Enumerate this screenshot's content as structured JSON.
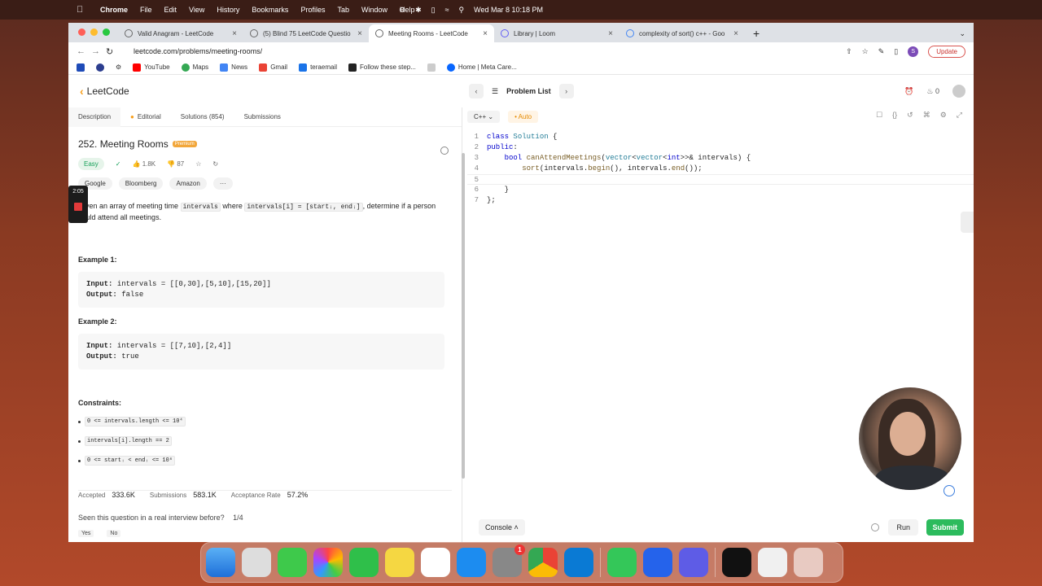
{
  "menubar": {
    "app": "Chrome",
    "items": [
      "File",
      "Edit",
      "View",
      "History",
      "Bookmarks",
      "Profiles",
      "Tab",
      "Window",
      "Help"
    ],
    "datetime": "Wed Mar 8  10:18 PM"
  },
  "browser": {
    "tabs": [
      {
        "label": "Valid Anagram - LeetCode",
        "icon": "leetcode-icon",
        "active": false
      },
      {
        "label": "(5) Blind 75 LeetCode Questio",
        "icon": "leetcode-icon",
        "active": false
      },
      {
        "label": "Meeting Rooms - LeetCode",
        "icon": "leetcode-icon",
        "active": true
      },
      {
        "label": "Library | Loom",
        "icon": "loom-icon",
        "active": false
      },
      {
        "label": "complexity of sort() c++ - Goo",
        "icon": "google-icon",
        "active": false
      }
    ],
    "url": "leetcode.com/problems/meeting-rooms/",
    "update_label": "Update",
    "profile_initial": "S",
    "bookmarks": [
      "YouTube",
      "Maps",
      "News",
      "Gmail",
      "teraemail",
      "Follow these step...",
      "Home | Meta Care..."
    ]
  },
  "lc_header": {
    "logo": "LeetCode",
    "problem_list": "Problem List",
    "streak": "0"
  },
  "left_tabs": [
    "Description",
    "Editorial",
    "Solutions (854)",
    "Submissions"
  ],
  "problem": {
    "title": "252. Meeting Rooms",
    "premium": "Premium",
    "difficulty": "Easy",
    "likes": "1.8K",
    "dislikes": "87",
    "companies": [
      "Google",
      "Bloomberg",
      "Amazon",
      "···"
    ],
    "desc_pre": "Given an array of meeting time",
    "desc_code1": "intervals",
    "desc_mid": "where",
    "desc_code2": "intervals[i] = [startᵢ, endᵢ]",
    "desc_post": ", determine if a person could attend all meetings.",
    "example1_label": "Example 1:",
    "example1_input_label": "Input:",
    "example1_input": "intervals = [[0,30],[5,10],[15,20]]",
    "example1_output_label": "Output:",
    "example1_output": "false",
    "example2_label": "Example 2:",
    "example2_input_label": "Input:",
    "example2_input": "intervals = [[7,10],[2,4]]",
    "example2_output_label": "Output:",
    "example2_output": "true",
    "constraints_label": "Constraints:",
    "constraints": [
      "0 <= intervals.length <= 10⁴",
      "intervals[i].length == 2",
      "0 <= startᵢ < endᵢ <= 10⁶"
    ],
    "accepted_label": "Accepted",
    "accepted": "333.6K",
    "submissions_label": "Submissions",
    "submissions": "583.1K",
    "acceptance_label": "Acceptance Rate",
    "acceptance": "57.2%",
    "seen_question": "Seen this question in a real interview before?",
    "seen_count": "1/4",
    "yes": "Yes",
    "no": "No"
  },
  "recording": {
    "time": "2:05"
  },
  "editor": {
    "language": "C++",
    "mode": "Auto",
    "lines": [
      "1",
      "2",
      "3",
      "4",
      "5",
      "6",
      "7"
    ],
    "console": "Console",
    "run": "Run",
    "submit": "Submit"
  },
  "colors": {
    "accent": "#f89f1b",
    "submit": "#2cbb5d",
    "easy": "#19a15a"
  }
}
